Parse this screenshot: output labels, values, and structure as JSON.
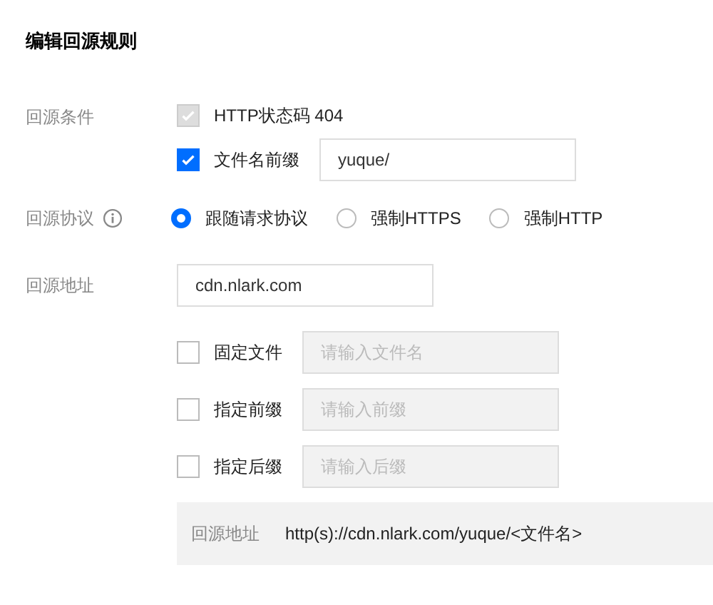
{
  "title": "编辑回源规则",
  "conditions": {
    "label": "回源条件",
    "items": [
      {
        "label": "HTTP状态码 404",
        "checked": true,
        "disabled": true
      },
      {
        "label": "文件名前缀",
        "checked": true,
        "disabled": false,
        "value": "yuque/"
      }
    ]
  },
  "protocol": {
    "label": "回源协议",
    "options": [
      {
        "label": "跟随请求协议",
        "selected": true
      },
      {
        "label": "强制HTTPS",
        "selected": false
      },
      {
        "label": "强制HTTP",
        "selected": false
      }
    ]
  },
  "address": {
    "label": "回源地址",
    "value": "cdn.nlark.com"
  },
  "rewrite_options": [
    {
      "label": "固定文件",
      "checked": false,
      "placeholder": "请输入文件名"
    },
    {
      "label": "指定前缀",
      "checked": false,
      "placeholder": "请输入前缀"
    },
    {
      "label": "指定后缀",
      "checked": false,
      "placeholder": "请输入后缀"
    }
  ],
  "preview": {
    "label": "回源地址",
    "value": "http(s)://cdn.nlark.com/yuque/<文件名>"
  }
}
